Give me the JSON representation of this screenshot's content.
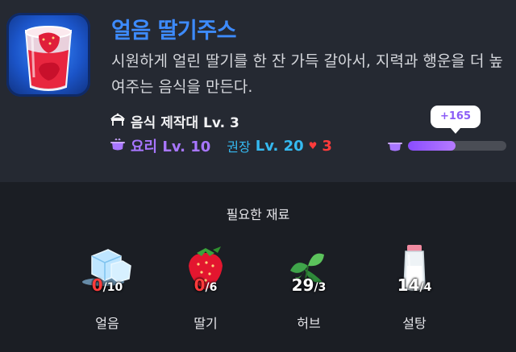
{
  "item": {
    "name": "얼음 딸기주스",
    "description": "시원하게 얼린 딸기를 한 잔 가득 갈아서, 지력과 행운을 더 높여주는 음식을 만든다.",
    "icon": "strawberry-juice-icon"
  },
  "station": {
    "icon": "cooking-station-icon",
    "label": "음식 제작대 Lv. 3"
  },
  "skill": {
    "label": "요리 Lv. 10",
    "recommend_label": "권장",
    "recommend_level": "Lv. 20",
    "heart": "♥",
    "gap": "3"
  },
  "xp": {
    "gain": "+165",
    "fill_fraction": 0.48,
    "color": "#a876ff"
  },
  "requirements": {
    "title": "필요한 재료",
    "materials": [
      {
        "name": "얼음",
        "have": "0",
        "need": "/10",
        "enough": false,
        "icon": "ice-icon"
      },
      {
        "name": "딸기",
        "have": "0",
        "need": "/6",
        "enough": false,
        "icon": "strawberry-icon"
      },
      {
        "name": "허브",
        "have": "29",
        "need": "/3",
        "enough": true,
        "icon": "herb-icon"
      },
      {
        "name": "설탕",
        "have": "14",
        "need": "/4",
        "enough": true,
        "icon": "sugar-icon"
      }
    ]
  },
  "colors": {
    "title": "#3d8bff",
    "purple": "#a876ff",
    "cyan": "#35b9f0",
    "red": "#ff3b3b"
  }
}
